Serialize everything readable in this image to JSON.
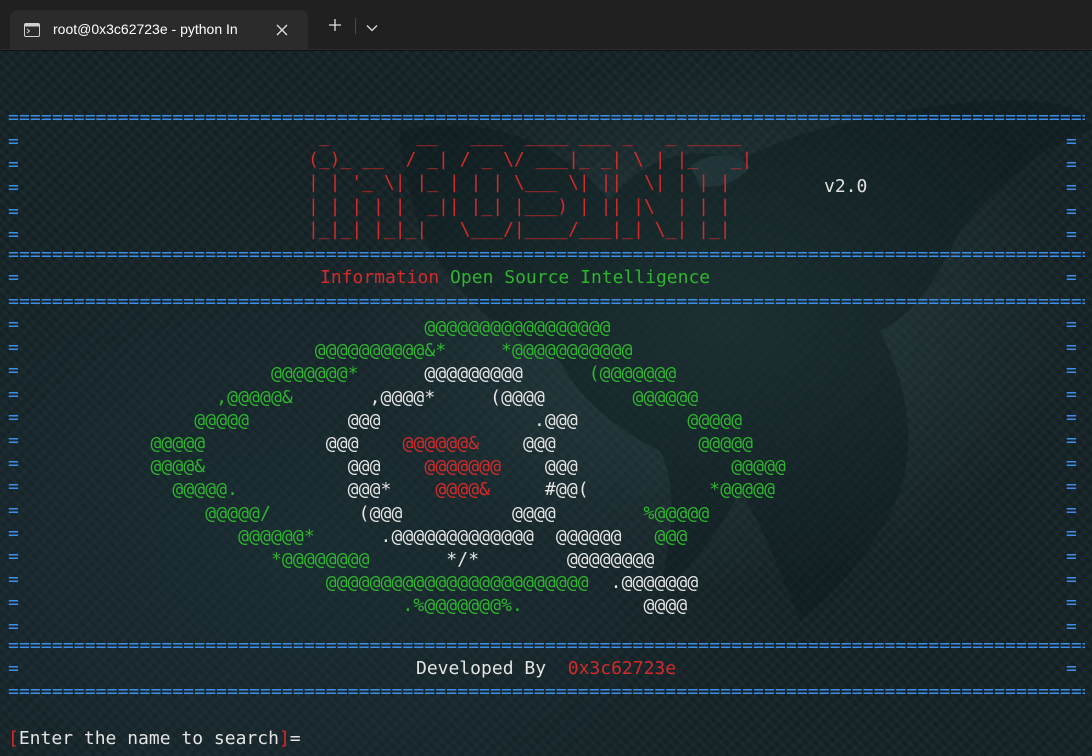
{
  "window": {
    "tab_title": "root@0x3c62723e - python  In",
    "tab_icon": "terminal-icon",
    "close_icon": "close-icon",
    "new_tab_icon": "plus-icon",
    "dropdown_icon": "chevron-down-icon"
  },
  "terminal": {
    "rule": "====================================================================================================================================================================",
    "edge_left": "=\n=\n=\n=\n=",
    "edge_right": "=\n=\n=\n=\n=",
    "edge_left_logo": "=\n=\n=\n=\n=\n=\n=\n=\n=\n=\n=\n=\n=\n=",
    "edge_right_logo": "=\n=\n=\n=\n=\n=\n=\n=\n=\n=\n=\n=\n=\n=",
    "edge_dev": "=",
    "banner": " _        __   ___  ____ ___ _   _ _____\n(_)_ __  / _| / _ \\/ ___|_ _| \\ | |_   _|\n| | '_ \\| |_ | | | \\___ \\| ||  \\| | | |\n| | | | |  _|| |_| |___) | || |\\  | | |\n|_|_| |_|_|   \\___/|____/___|_| \\_| |_|",
    "version": "v2.0",
    "subtitle": {
      "word1": "Information",
      "word2": " Open",
      "word3": " Source",
      "word4": " Intelligence"
    },
    "logo": [
      [
        {
          "t": "                                      ",
          "c": "g"
        },
        {
          "t": "@@@@@@@@@@@@@@@@@",
          "c": "g"
        }
      ],
      [
        {
          "t": "                            ",
          "c": "g"
        },
        {
          "t": "@@@@@@@@@@&*     *@@@@@@@@@@@",
          "c": "g"
        }
      ],
      [
        {
          "t": "                        ",
          "c": "g"
        },
        {
          "t": "@@@@@@@*",
          "c": "g"
        },
        {
          "t": "      @@@@@@@@@",
          "c": "w"
        },
        {
          "t": "      (@@@@@@@",
          "c": "g"
        }
      ],
      [
        {
          "t": "                   ",
          "c": "g"
        },
        {
          "t": ",@@@@@&",
          "c": "g"
        },
        {
          "t": "       ,@@@@*     (@@@@",
          "c": "w"
        },
        {
          "t": "        @@@@@@",
          "c": "g"
        }
      ],
      [
        {
          "t": "                 ",
          "c": "g"
        },
        {
          "t": "@@@@@",
          "c": "g"
        },
        {
          "t": "         @@@              .@@@",
          "c": "w"
        },
        {
          "t": "          @@@@@",
          "c": "g"
        }
      ],
      [
        {
          "t": "             ",
          "c": "g"
        },
        {
          "t": "@@@@@",
          "c": "g"
        },
        {
          "t": "           @@@    ",
          "c": "w"
        },
        {
          "t": "@@@@@@&",
          "c": "r"
        },
        {
          "t": "    @@@",
          "c": "w"
        },
        {
          "t": "             @@@@@",
          "c": "g"
        }
      ],
      [
        {
          "t": "             ",
          "c": "g"
        },
        {
          "t": "@@@@&",
          "c": "g"
        },
        {
          "t": "             @@@    ",
          "c": "w"
        },
        {
          "t": "@@@@@@@",
          "c": "r"
        },
        {
          "t": "    @@@",
          "c": "w"
        },
        {
          "t": "              @@@@@",
          "c": "g"
        }
      ],
      [
        {
          "t": "               ",
          "c": "g"
        },
        {
          "t": "@@@@@.",
          "c": "g"
        },
        {
          "t": "          @@@*    ",
          "c": "w"
        },
        {
          "t": "@@@@&",
          "c": "r"
        },
        {
          "t": "     #@@(",
          "c": "w"
        },
        {
          "t": "           *@@@@@",
          "c": "g"
        }
      ],
      [
        {
          "t": "                  ",
          "c": "g"
        },
        {
          "t": "@@@@@/",
          "c": "g"
        },
        {
          "t": "        (@@@          @@@@",
          "c": "w"
        },
        {
          "t": "        %@@@@@",
          "c": "g"
        }
      ],
      [
        {
          "t": "                     ",
          "c": "g"
        },
        {
          "t": "@@@@@@*",
          "c": "g"
        },
        {
          "t": "      .@@@@@@@@@@@@@  @@@@@@   ",
          "c": "w"
        },
        {
          "t": "@@@",
          "c": "g"
        }
      ],
      [
        {
          "t": "                        ",
          "c": "g"
        },
        {
          "t": "*@@@@@@@@",
          "c": "g"
        },
        {
          "t": "       */*        @@@@@@@@",
          "c": "w"
        }
      ],
      [
        {
          "t": "                             ",
          "c": "g"
        },
        {
          "t": "@@@@@@@@@@@@@@@@@@@@@@@@",
          "c": "g"
        },
        {
          "t": "  .@@@@@@@",
          "c": "w"
        }
      ],
      [
        {
          "t": "                                    ",
          "c": "g"
        },
        {
          "t": ".%@@@@@@@%.",
          "c": "g"
        },
        {
          "t": "           @@@@",
          "c": "w"
        }
      ],
      [
        {
          "t": "",
          "c": "g"
        }
      ]
    ],
    "developed_by": "Developed By",
    "developer": "0x3c62723e",
    "prompt_open": "[",
    "prompt_text": "Enter the name to search",
    "prompt_close": "]",
    "prompt_eq": "="
  },
  "colors": {
    "rule_blue": "#3b8eea",
    "banner_red": "#d52a2a",
    "green": "#2fb52f",
    "white": "#e4e4e4",
    "background": "#142226"
  }
}
